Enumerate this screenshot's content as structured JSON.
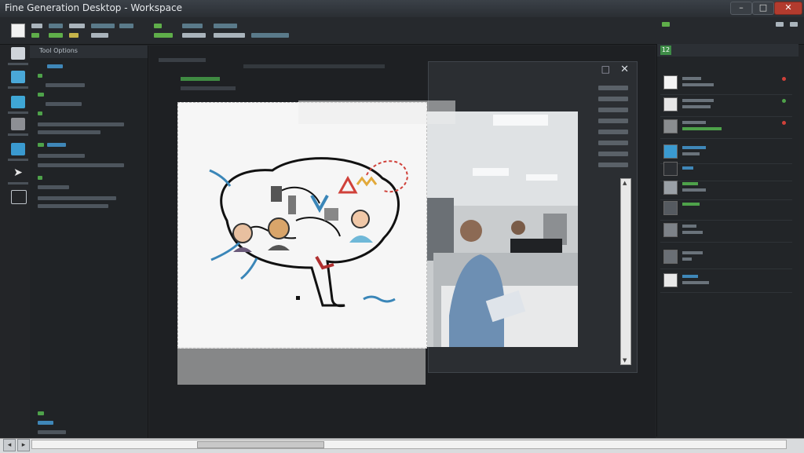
{
  "window": {
    "title": "Fine Generation Desktop - Workspace",
    "minimize_label": "–",
    "maximize_label": "□",
    "close_label": "✕"
  },
  "left_panel": {
    "header": "Tool Options"
  },
  "dialog": {
    "close_label": "✕",
    "maximize_label": "□"
  },
  "right_panel": {
    "tab_label": "12"
  },
  "icons": {
    "dialog_scroll_up": "▲",
    "dialog_scroll_down": "▼",
    "status_left": "◂",
    "status_right": "▸"
  },
  "colors": {
    "accent_green": "#4ea24a",
    "accent_blue": "#3f87b8",
    "close_red": "#b23b2e"
  }
}
